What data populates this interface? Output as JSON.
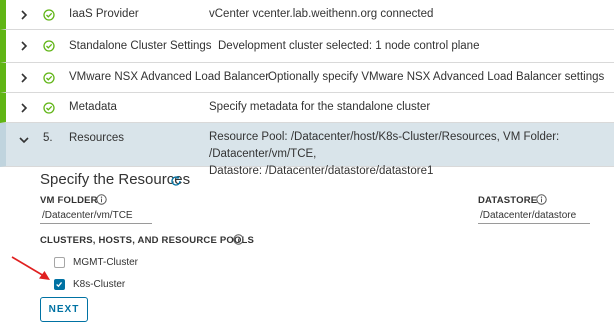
{
  "steps": [
    {
      "title": "IaaS Provider",
      "desc": "vCenter vcenter.lab.weithenn.org connected"
    },
    {
      "title": "Standalone Cluster Settings",
      "desc": "Development cluster selected: 1 node control plane"
    },
    {
      "title": "VMware NSX Advanced Load Balancer",
      "desc": "Optionally specify VMware NSX Advanced Load Balancer settings"
    },
    {
      "title": "Metadata",
      "desc": "Specify metadata for the standalone cluster"
    }
  ],
  "active_step": {
    "number": "5.",
    "title": "Resources",
    "desc_line1": "Resource Pool: /Datacenter/host/K8s-Cluster/Resources, VM Folder: /Datacenter/vm/TCE,",
    "desc_line2": "Datastore: /Datacenter/datastore/datastore1"
  },
  "resources": {
    "title": "Specify the Resources",
    "vm_folder_label": "VM FOLDER",
    "vm_folder_value": "/Datacenter/vm/TCE",
    "datastore_label": "DATASTORE",
    "datastore_value": "/Datacenter/datastore",
    "pools_label": "CLUSTERS, HOSTS, AND RESOURCE POOLS",
    "pools": [
      {
        "label": "MGMT-Cluster",
        "checked": false
      },
      {
        "label": "K8s-Cluster",
        "checked": true
      }
    ],
    "next_label": "NEXT"
  },
  "colors": {
    "success": "#60b515",
    "active_bg": "#d9e4ea",
    "primary": "#0072a3",
    "annotation_arrow": "#e02020"
  }
}
